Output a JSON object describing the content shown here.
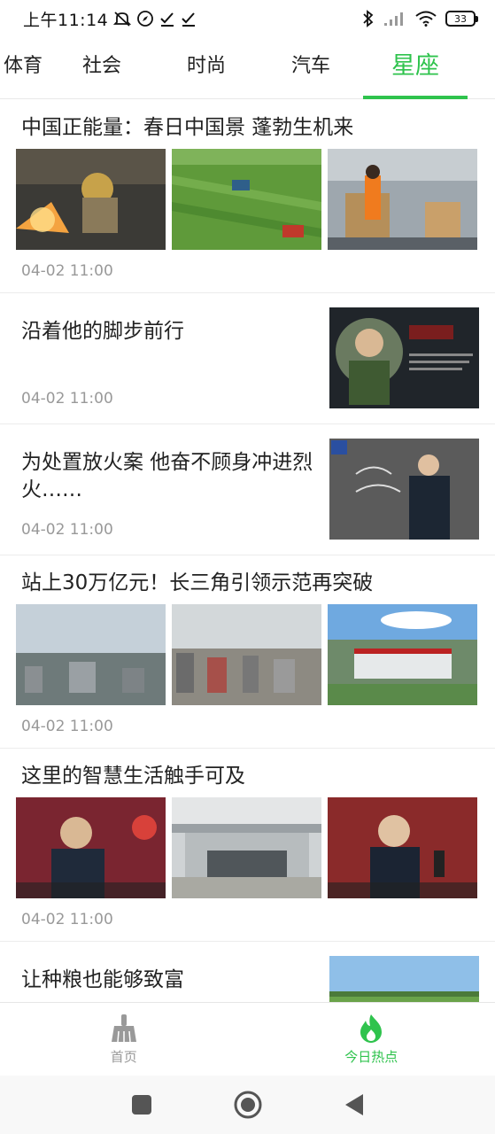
{
  "status_bar": {
    "time": "上午11:14",
    "battery": "33",
    "icons": [
      "mute-icon",
      "compass-icon",
      "check-icon",
      "check-icon",
      "bluetooth-icon",
      "signal-icon",
      "wifi-icon",
      "battery-icon"
    ]
  },
  "tabs": [
    {
      "label": "体育",
      "active": false
    },
    {
      "label": "社会",
      "active": false
    },
    {
      "label": "时尚",
      "active": false
    },
    {
      "label": "汽车",
      "active": false
    },
    {
      "label": "星座",
      "active": true
    }
  ],
  "articles": [
    {
      "title": "中国正能量：春日中国景 蓬勃生机来",
      "time": "04-02 11:00",
      "layout": "three-images"
    },
    {
      "title": "沿着他的脚步前行",
      "time": "04-02 11:00",
      "layout": "single-image"
    },
    {
      "title": "为处置放火案 他奋不顾身冲进烈火……",
      "time": "04-02 11:00",
      "layout": "single-image"
    },
    {
      "title": "站上30万亿元！长三角引领示范再突破",
      "time": "04-02 11:00",
      "layout": "three-images"
    },
    {
      "title": "这里的智慧生活触手可及",
      "time": "04-02 11:00",
      "layout": "three-images"
    },
    {
      "title": "让种粮也能够致富",
      "time": "",
      "layout": "single-image"
    }
  ],
  "bottom_nav": [
    {
      "label": "首页",
      "icon": "broom-icon",
      "active": false
    },
    {
      "label": "今日热点",
      "icon": "flame-icon",
      "active": true
    }
  ],
  "colors": {
    "accent": "#2fc34d",
    "muted": "#999999"
  }
}
